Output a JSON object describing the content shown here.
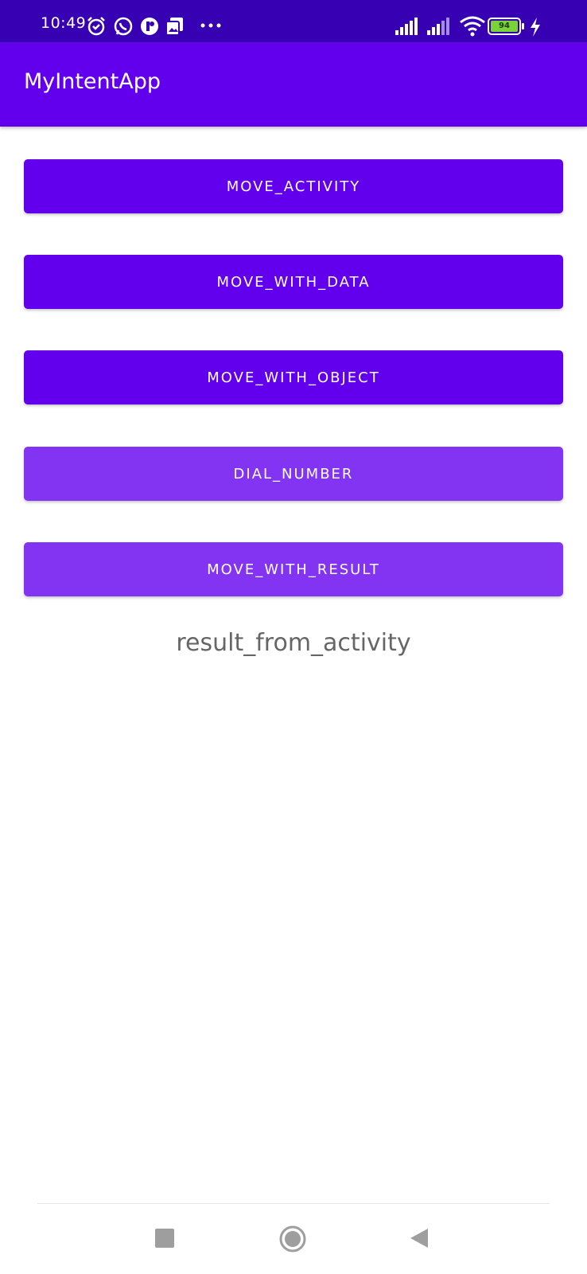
{
  "status_bar": {
    "time": "10:49",
    "battery_level": "94",
    "icons_left": [
      "alarm-icon",
      "whatsapp-icon",
      "app-notification-icon",
      "gallery-icon",
      "more-notifications-icon"
    ],
    "icons_right": [
      "signal-icon",
      "signal-icon",
      "wifi-icon",
      "battery-icon",
      "charging-icon"
    ]
  },
  "app_bar": {
    "title": "MyIntentApp"
  },
  "buttons": {
    "move_activity": "MOVE_ACTIVITY",
    "move_with_data": "MOVE_WITH_DATA",
    "move_with_object": "MOVE_WITH_OBJECT",
    "dial_number": "DIAL_NUMBER",
    "move_with_result": "MOVE_WITH_RESULT"
  },
  "result": {
    "text": "result_from_activity"
  },
  "nav_bar": {
    "items": [
      "recents-icon",
      "home-icon",
      "back-icon"
    ]
  },
  "colors": {
    "status_bar": "#3700b3",
    "primary": "#6200ee",
    "button_light": "#8333f2",
    "result_text": "#666666"
  }
}
